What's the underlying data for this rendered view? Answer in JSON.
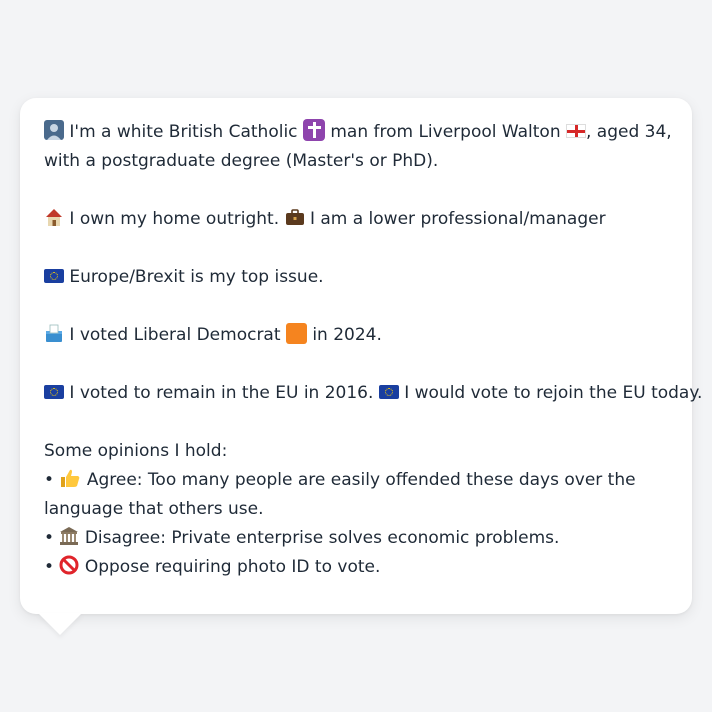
{
  "lines": {
    "intro_a": "I'm a white British Catholic",
    "intro_b": "man from Liverpool Walton",
    "intro_c": ", aged 34,",
    "intro_d": "with a postgraduate degree (Master's or PhD).",
    "home": "I own my home outright.",
    "job": "I am a lower professional/manager",
    "issue": "Europe/Brexit is my top issue.",
    "vote_a": "I voted Liberal Democrat",
    "vote_b": "in 2024.",
    "eu_a": "I voted to remain in the EU in 2016.",
    "eu_b": "I would vote to rejoin the EU today.",
    "opinions_heading": "Some opinions I hold:",
    "op1_a": "Agree: Too many people are easily offended these days over the",
    "op1_b": "language that others use.",
    "op2": "Disagree: Private enterprise solves economic problems.",
    "op3": "Oppose requiring photo ID to vote."
  },
  "icons": {
    "person": "person-icon",
    "religion": "latin-cross-icon",
    "flag": "england-flag-icon",
    "home": "house-icon",
    "briefcase": "briefcase-icon",
    "eu": "eu-flag-icon",
    "ballot": "ballot-box-icon",
    "party_color": "#f5841f",
    "thumbs": "thumbs-up-icon",
    "building": "classical-building-icon",
    "no_entry": "prohibited-icon"
  }
}
